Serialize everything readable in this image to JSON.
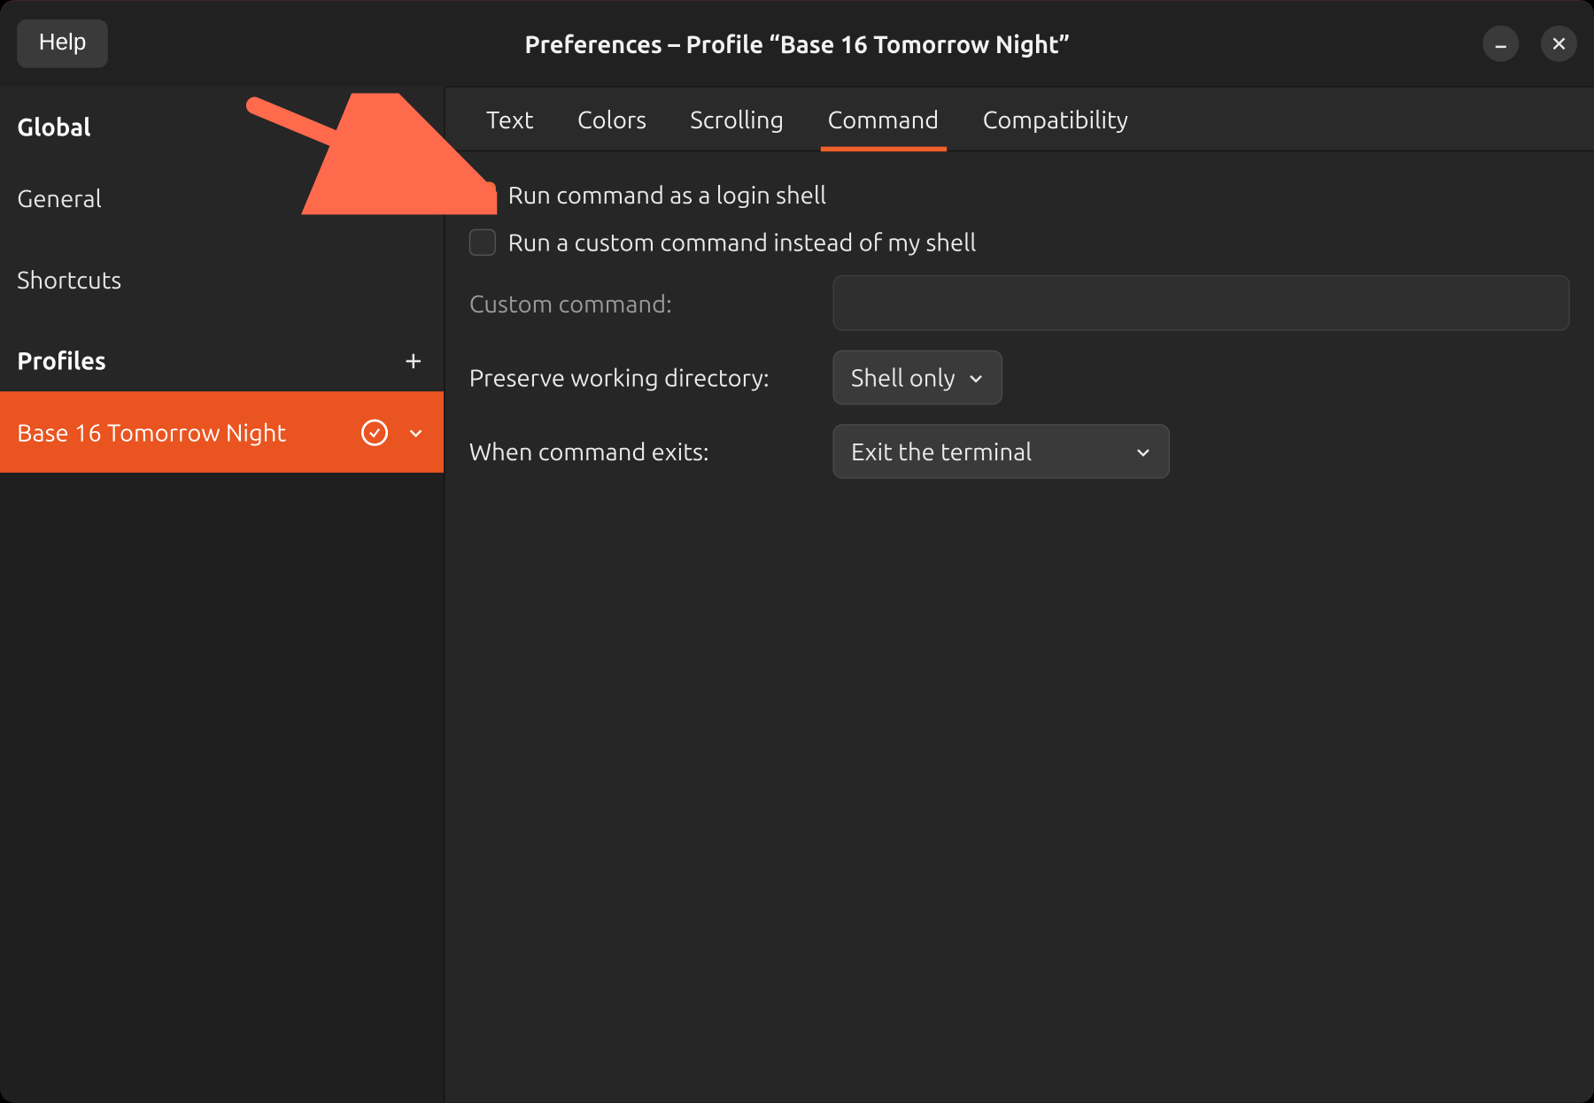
{
  "header": {
    "help_label": "Help",
    "title": "Preferences – Profile “Base 16 Tomorrow Night”"
  },
  "sidebar": {
    "global_heading": "Global",
    "general_item": "General",
    "shortcuts_item": "Shortcuts",
    "profiles_heading": "Profiles",
    "profile_name": "Base 16 Tomorrow Night"
  },
  "tabs": {
    "text": "Text",
    "colors": "Colors",
    "scrolling": "Scrolling",
    "command": "Command",
    "compatibility": "Compatibility",
    "active": "command"
  },
  "command_form": {
    "login_shell": {
      "label": "Run command as a login shell",
      "checked": true
    },
    "custom_command_check": {
      "label": "Run a custom command instead of my shell",
      "checked": false
    },
    "custom_command_field": {
      "label": "Custom command:",
      "value": "",
      "enabled": false
    },
    "preserve_wd": {
      "label": "Preserve working directory:",
      "value": "Shell only"
    },
    "when_exits": {
      "label": "When command exits:",
      "value": "Exit the terminal"
    }
  },
  "colors": {
    "accent": "#e95420"
  }
}
